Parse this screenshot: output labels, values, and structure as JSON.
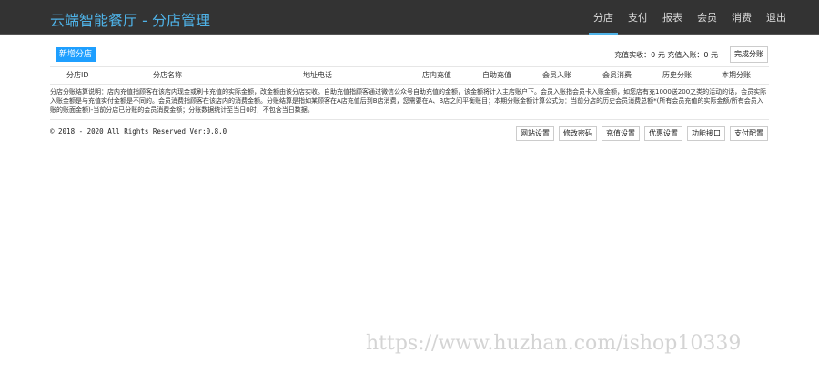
{
  "header": {
    "title": "云端智能餐厅 - 分店管理",
    "nav": [
      "分店",
      "支付",
      "报表",
      "会员",
      "消费",
      "退出"
    ],
    "active": "分店"
  },
  "toolbar": {
    "add_label": "新增分店",
    "stats": "充值实收：0 元 充值入账：0 元",
    "done_label": "完成分账"
  },
  "table": {
    "columns": [
      "分店ID",
      "分店名称",
      "地址电话",
      "店内充值",
      "自助充值",
      "会员入账",
      "会员消费",
      "历史分账",
      "本期分账"
    ]
  },
  "notes": "分店分账结算说明：店内充值指顾客在该店内现金或刷卡充值的实际金额，改金额由该分店实收。自助充值指顾客通过微信公众号自助充值的金额，该金额将计入主店账户下。会员入账指会员卡入账金额，如您店有充1000送200之类的活动的话，会员实际入账金额是与充值实付金额是不同的。会员消费指顾客在该店内的消费金额。分账结算是指如某顾客在A店充值后到B店消费，您需要在A、B店之间平衡账目；本期分账金额计算公式为：当前分店的历史会员消费总额*(所有会员充值的实际金额/所有会员入账的账面金额)-当前分店已分账的会员消费金额；分账数据统计至当日0时，不包含当日数据。",
  "footer": {
    "copyright": "© 2018 - 2020 All Rights Reserved Ver:0.8.0",
    "buttons": [
      "网站设置",
      "修改密码",
      "充值设置",
      "优惠设置",
      "功能接口",
      "支付配置"
    ]
  },
  "watermark": "https://www.huzhan.com/ishop10339"
}
